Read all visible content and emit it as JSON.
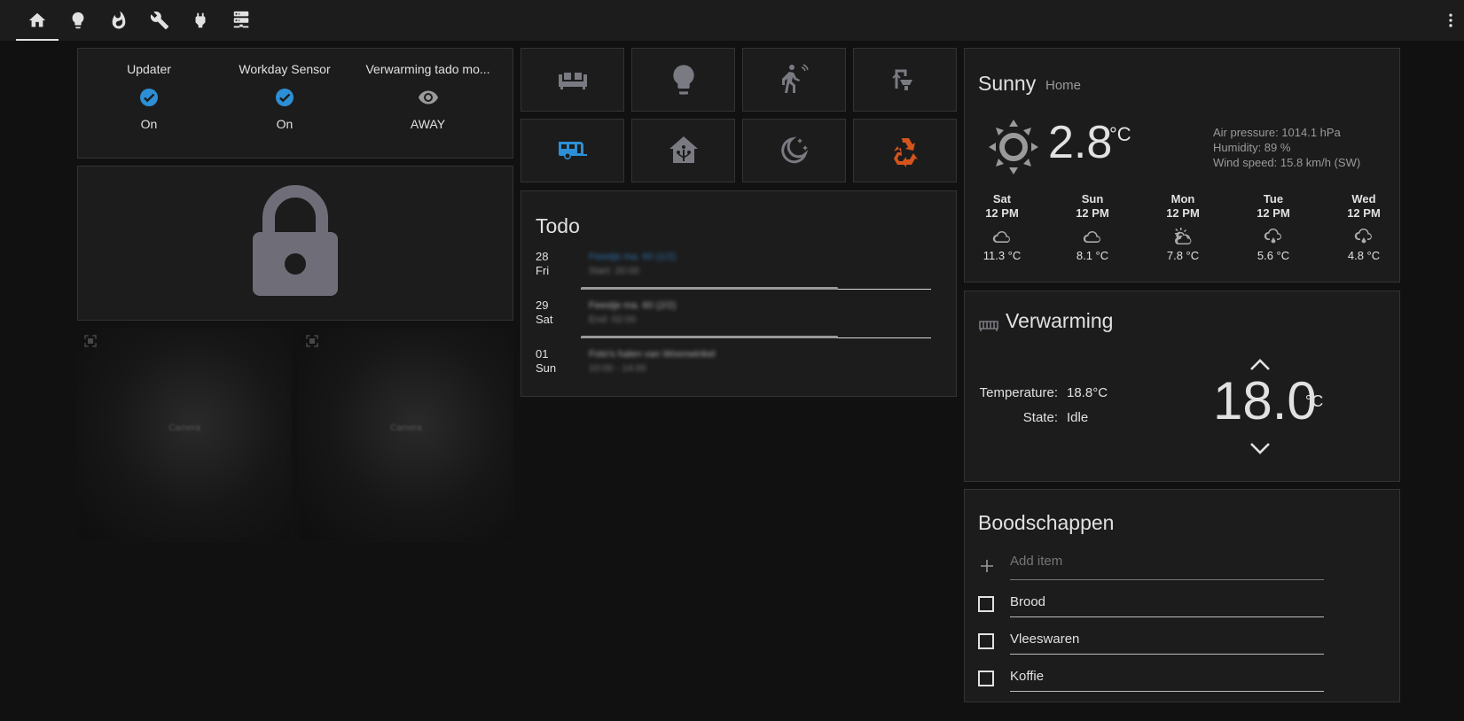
{
  "toolbar": {
    "tabs": [
      {
        "icon": "home-icon",
        "active": true
      },
      {
        "icon": "lightbulb-icon"
      },
      {
        "icon": "fire-icon"
      },
      {
        "icon": "wrench-icon"
      },
      {
        "icon": "power-plug-icon"
      },
      {
        "icon": "server-icon"
      }
    ],
    "menu_icon": "dots-vertical-icon"
  },
  "glance": {
    "items": [
      {
        "name": "Updater",
        "state": "On",
        "icon": "check-circle-icon",
        "color": "#2d8fd5"
      },
      {
        "name": "Workday Sensor",
        "state": "On",
        "icon": "check-circle-icon",
        "color": "#2d8fd5"
      },
      {
        "name": "Verwarming tado mo...",
        "state": "AWAY",
        "icon": "eye-icon",
        "color": "#9a9a9a"
      }
    ]
  },
  "lock": {
    "icon": "lock-icon",
    "color": "#6f6e78"
  },
  "cameras": [
    {
      "label": "Camera"
    },
    {
      "label": "Camera"
    }
  ],
  "buttons": [
    {
      "icon": "sofa-icon",
      "color": "#7a7a82"
    },
    {
      "icon": "lightbulb-icon",
      "color": "#7a7a82"
    },
    {
      "icon": "motion-sensor-icon",
      "color": "#7a7a82"
    },
    {
      "icon": "outdoor-lamp-icon",
      "color": "#7a7a82"
    },
    {
      "icon": "caravan-icon",
      "color": "#2d8fd5"
    },
    {
      "icon": "home-automation-icon",
      "color": "#7a7a82"
    },
    {
      "icon": "weather-night-icon",
      "color": "#7a7a82"
    },
    {
      "icon": "recycle-icon",
      "color": "#d4541c"
    }
  ],
  "todo": {
    "title": "Todo",
    "days": [
      {
        "num": "28",
        "dow": "Fri",
        "title": "Feestje ma. 60 (1/2)",
        "sub": "Start: 20:00"
      },
      {
        "num": "29",
        "dow": "Sat",
        "title": "Feestje ma. 60 (2/2)",
        "sub": "End: 02:00"
      },
      {
        "num": "01",
        "dow": "Sun",
        "title": "Foto's halen van Woonwinkel",
        "sub": "10:00 - 14:00"
      }
    ]
  },
  "weather": {
    "state": "Sunny",
    "name": "Home",
    "icon": "weather-sunny-icon",
    "temperature": "2.8",
    "unit": "°C",
    "attributes": [
      "Air pressure: 1014.1 hPa",
      "Humidity: 89 %",
      "Wind speed: 15.8 km/h (SW)"
    ],
    "forecast": [
      {
        "day": "Sat",
        "time": "12 PM",
        "icon": "cloudy-icon",
        "temp": "11.3 °C"
      },
      {
        "day": "Sun",
        "time": "12 PM",
        "icon": "cloudy-icon",
        "temp": "8.1 °C"
      },
      {
        "day": "Mon",
        "time": "12 PM",
        "icon": "partly-cloudy-icon",
        "temp": "7.8 °C"
      },
      {
        "day": "Tue",
        "time": "12 PM",
        "icon": "rainy-icon",
        "temp": "5.6 °C"
      },
      {
        "day": "Wed",
        "time": "12 PM",
        "icon": "rainy-icon",
        "temp": "4.8 °C"
      }
    ]
  },
  "thermostat": {
    "title": "Verwarming",
    "icon": "radiator-icon",
    "temperature_label": "Temperature:",
    "temperature_value": "18.8°C",
    "state_label": "State:",
    "state_value": "Idle",
    "target": "18.0",
    "unit": "°C"
  },
  "shopping": {
    "title": "Boodschappen",
    "add_placeholder": "Add item",
    "items": [
      "Brood",
      "Vleeswaren",
      "Koffie"
    ]
  }
}
